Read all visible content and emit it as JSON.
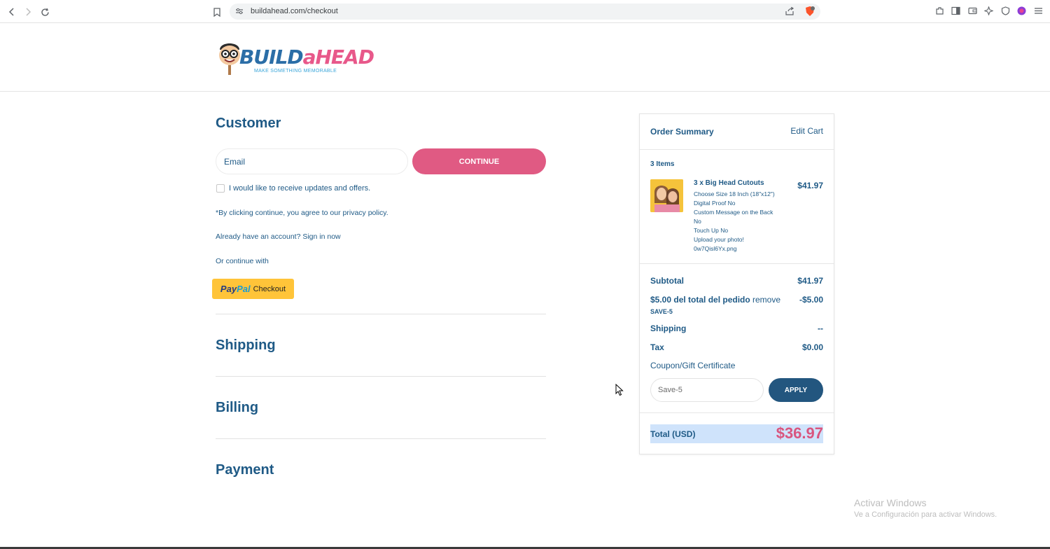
{
  "browser": {
    "url": "buildahead.com/checkout",
    "icons": [
      "back-icon",
      "forward-icon",
      "reload-icon",
      "bookmark-icon",
      "site-info-icon",
      "share-icon",
      "brave-shield-icon",
      "extensions-icon",
      "sidebar-icon",
      "wallet-icon",
      "leo-icon",
      "vpn-icon",
      "profile-icon",
      "menu-icon"
    ]
  },
  "logo": {
    "word_build": "BUILD",
    "word_a": "a",
    "word_head": "HEAD",
    "tagline": "MAKE SOMETHING MEMORABLE"
  },
  "customer": {
    "title": "Customer",
    "email_placeholder": "Email",
    "continue_label": "CONTINUE",
    "updates_label": "I would like to receive updates and offers.",
    "privacy_text": "*By clicking continue, you agree to our privacy policy.",
    "account_text": "Already have an account? Sign in now",
    "or_continue": "Or continue with",
    "paypal_logo_pay": "Pay",
    "paypal_logo_pal": "Pal",
    "paypal_label": "Checkout"
  },
  "sections": {
    "shipping": "Shipping",
    "billing": "Billing",
    "payment": "Payment"
  },
  "summary": {
    "title": "Order Summary",
    "edit_cart": "Edit Cart",
    "items_count": "3 Items",
    "item": {
      "name": "3 x Big Head Cutouts",
      "price": "$41.97",
      "options": [
        "Choose Size 18 Inch (18\"x12\")",
        "Digital Proof No",
        "Custom Message on the Back",
        "No",
        "Touch Up No",
        "Upload your photo!",
        "0w7Qisl6Yx.png"
      ]
    },
    "subtotal_label": "Subtotal",
    "subtotal_value": "$41.97",
    "discount_label": "$5.00 del total del pedido",
    "discount_remove": "remove",
    "discount_value": "-$5.00",
    "discount_code": "SAVE-5",
    "shipping_label": "Shipping",
    "shipping_value": "--",
    "tax_label": "Tax",
    "tax_value": "$0.00",
    "coupon_label": "Coupon/Gift Certificate",
    "coupon_value": "Save-5",
    "apply_label": "APPLY",
    "total_label": "Total (USD)",
    "total_value": "$36.97"
  },
  "watermark": {
    "line1": "Activar Windows",
    "line2": "Ve a Configuración para activar Windows."
  },
  "colors": {
    "brand_blue": "#1f5a86",
    "accent_pink": "#e05a83",
    "paypal_yellow": "#ffc439",
    "apply_blue": "#23567f",
    "total_highlight": "#cfe3fb"
  }
}
